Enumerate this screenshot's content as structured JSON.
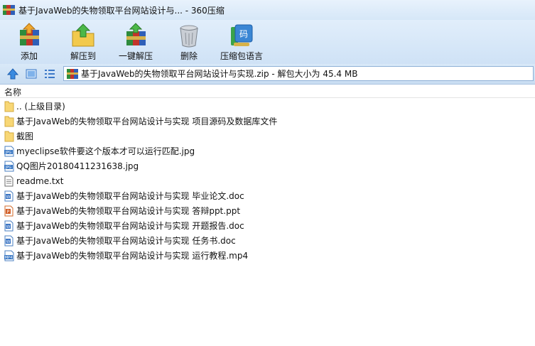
{
  "window": {
    "title": "基于JavaWeb的失物领取平台网站设计与... - 360压缩"
  },
  "toolbar": {
    "items": [
      {
        "label": "添加",
        "icon": "add-archive-icon"
      },
      {
        "label": "解压到",
        "icon": "extract-to-icon"
      },
      {
        "label": "一键解压",
        "icon": "one-click-extract-icon"
      },
      {
        "label": "删除",
        "icon": "trash-icon"
      },
      {
        "label": "压缩包语言",
        "icon": "archive-language-icon"
      }
    ]
  },
  "address": {
    "text": "基于JavaWeb的失物领取平台网站设计与实现.zip - 解包大小为 45.4 MB"
  },
  "list": {
    "column_name": "名称",
    "items": [
      {
        "name": ".. (上级目录)",
        "type": "folder"
      },
      {
        "name": "基于JavaWeb的失物领取平台网站设计与实现 项目源码及数据库文件",
        "type": "folder"
      },
      {
        "name": "截图",
        "type": "folder"
      },
      {
        "name": "myeclipse软件要这个版本才可以运行匹配.jpg",
        "type": "jpg"
      },
      {
        "name": "QQ图片20180411231638.jpg",
        "type": "jpg"
      },
      {
        "name": "readme.txt",
        "type": "txt"
      },
      {
        "name": "基于JavaWeb的失物领取平台网站设计与实现 毕业论文.doc",
        "type": "doc"
      },
      {
        "name": "基于JavaWeb的失物领取平台网站设计与实现 答辩ppt.ppt",
        "type": "ppt"
      },
      {
        "name": "基于JavaWeb的失物领取平台网站设计与实现 开题报告.doc",
        "type": "doc"
      },
      {
        "name": "基于JavaWeb的失物领取平台网站设计与实现 任务书.doc",
        "type": "doc"
      },
      {
        "name": "基于JavaWeb的失物领取平台网站设计与实现 运行教程.mp4",
        "type": "mp4"
      }
    ]
  }
}
